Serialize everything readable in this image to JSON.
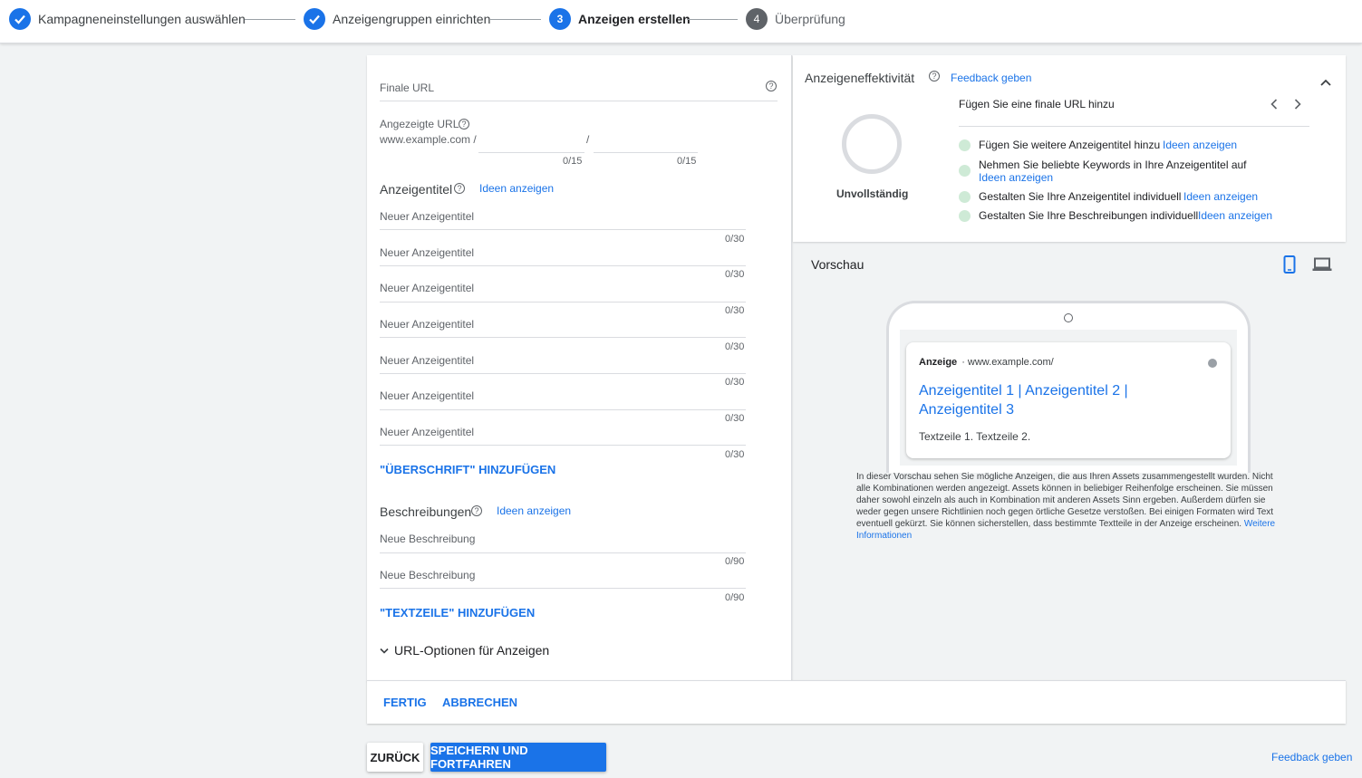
{
  "stepper": {
    "steps": [
      {
        "label": "Kampagneneinstellungen auswählen",
        "state": "done"
      },
      {
        "label": "Anzeigengruppen einrichten",
        "state": "done"
      },
      {
        "label": "Anzeigen erstellen",
        "number": "3",
        "state": "active"
      },
      {
        "label": "Überprüfung",
        "number": "4",
        "state": "todo"
      }
    ]
  },
  "form": {
    "final_url_label": "Finale URL",
    "display_url_label": "Angezeigte URL",
    "display_url_prefix": "www.example.com /",
    "display_url_sep": "/",
    "path_counter": "0/15",
    "headlines_title": "Anzeigentitel",
    "headlines_ideas": "Ideen anzeigen",
    "headlines": [
      {
        "placeholder": "Neuer Anzeigentitel",
        "counter": "0/30"
      },
      {
        "placeholder": "Neuer Anzeigentitel",
        "counter": "0/30"
      },
      {
        "placeholder": "Neuer Anzeigentitel",
        "counter": "0/30"
      },
      {
        "placeholder": "Neuer Anzeigentitel",
        "counter": "0/30"
      },
      {
        "placeholder": "Neuer Anzeigentitel",
        "counter": "0/30"
      },
      {
        "placeholder": "Neuer Anzeigentitel",
        "counter": "0/30"
      },
      {
        "placeholder": "Neuer Anzeigentitel",
        "counter": "0/30"
      }
    ],
    "add_headline": "\"ÜBERSCHRIFT\" HINZUFÜGEN",
    "descriptions_title": "Beschreibungen",
    "descriptions_ideas": "Ideen anzeigen",
    "descriptions": [
      {
        "placeholder": "Neue Beschreibung",
        "counter": "0/90"
      },
      {
        "placeholder": "Neue Beschreibung",
        "counter": "0/90"
      }
    ],
    "add_description": "\"TEXTZEILE\" HINZUFÜGEN",
    "url_options": "URL-Optionen für Anzeigen"
  },
  "effectiveness": {
    "title": "Anzeigeneffektivität",
    "feedback": "Feedback geben",
    "status": "Unvollständig",
    "tip": "Fügen Sie eine finale URL hinzu",
    "items": [
      {
        "text": "Fügen Sie weitere Anzeigentitel hinzu",
        "link": "Ideen anzeigen"
      },
      {
        "text": "Nehmen Sie beliebte Keywords in Ihre Anzeigentitel auf",
        "link": "Ideen anzeigen"
      },
      {
        "text": "Gestalten Sie Ihre Anzeigentitel individuell",
        "link": "Ideen anzeigen"
      },
      {
        "text": "Gestalten Sie Ihre Beschreibungen individuell",
        "link": "Ideen anzeigen"
      }
    ]
  },
  "preview": {
    "title": "Vorschau",
    "ad_label": "Anzeige",
    "ad_url": "· www.example.com/",
    "ad_headline": "Anzeigentitel 1 | Anzeigentitel 2 | Anzeigentitel 3",
    "ad_desc": "Textzeile 1. Textzeile 2.",
    "disclaimer": "In dieser Vorschau sehen Sie mögliche Anzeigen, die aus Ihren Assets zusammengestellt wurden. Nicht alle Kombinationen werden angezeigt. Assets können in beliebiger Reihenfolge erscheinen. Sie müssen daher sowohl einzeln als auch in Kombination mit anderen Assets Sinn ergeben. Außerdem dürfen sie weder gegen unsere Richtlinien noch gegen örtliche Gesetze verstoßen. Bei einigen Formaten wird Text eventuell gekürzt. Sie können sicherstellen, dass bestimmte Textteile in der Anzeige erscheinen.",
    "more_info": "Weitere Informationen"
  },
  "actions": {
    "done": "FERTIG",
    "cancel": "ABBRECHEN",
    "back": "ZURÜCK",
    "save": "SPEICHERN UND FORTFAHREN",
    "feedback": "Feedback geben"
  },
  "colors": {
    "accent": "#1a73e8",
    "dot": "#ceead6"
  }
}
